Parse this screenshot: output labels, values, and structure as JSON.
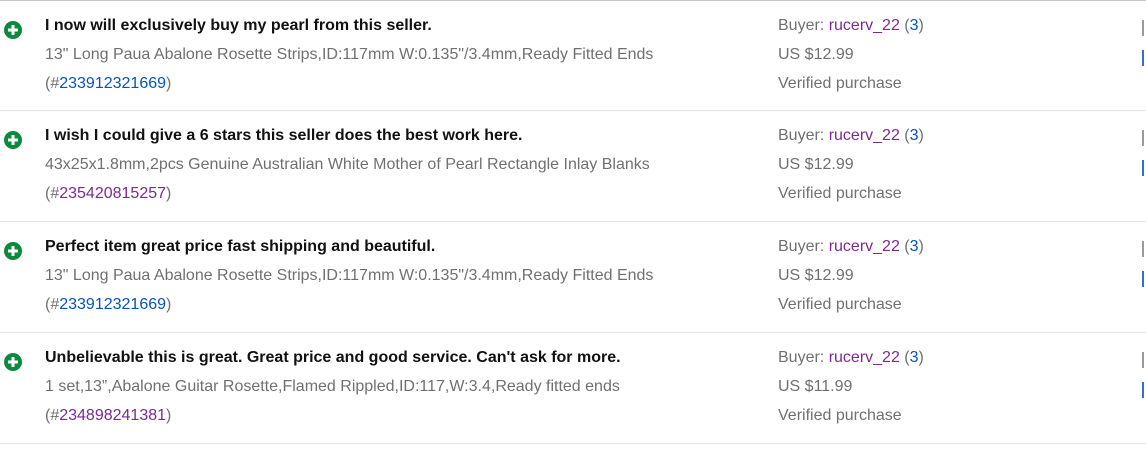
{
  "feedback": [
    {
      "comment": "I now will exclusively buy my pearl from this seller.",
      "item_title": "13\" Long Paua Abalone Rosette Strips,ID:117mm W:0.135\"/3.4mm,Ready Fitted Ends",
      "item_number_open": "(#",
      "item_number": "233912321669",
      "item_number_close": ")",
      "buyer_label": "Buyer: ",
      "buyer_name": "rucerv_22",
      "buyer_score_open": " (",
      "buyer_score": "3",
      "buyer_score_close": ")",
      "price": "US $12.99",
      "verified": "Verified purchase"
    },
    {
      "comment": "I wish I could give a 6 stars this seller does the best work here.",
      "item_title": "43x25x1.8mm,2pcs Genuine Australian White Mother of Pearl Rectangle Inlay Blanks",
      "item_number_open": "(#",
      "item_number": "235420815257",
      "item_number_close": ")",
      "buyer_label": "Buyer: ",
      "buyer_name": "rucerv_22",
      "buyer_score_open": " (",
      "buyer_score": "3",
      "buyer_score_close": ")",
      "price": "US $12.99",
      "verified": "Verified purchase"
    },
    {
      "comment": "Perfect item great price fast shipping and beautiful.",
      "item_title": "13\" Long Paua Abalone Rosette Strips,ID:117mm W:0.135\"/3.4mm,Ready Fitted Ends",
      "item_number_open": "(#",
      "item_number": "233912321669",
      "item_number_close": ")",
      "buyer_label": "Buyer: ",
      "buyer_name": "rucerv_22",
      "buyer_score_open": " (",
      "buyer_score": "3",
      "buyer_score_close": ")",
      "price": "US $12.99",
      "verified": "Verified purchase"
    },
    {
      "comment": "Unbelievable this is great. Great price and good service. Can't ask for more.",
      "item_title": "1 set,13”,Abalone Guitar Rosette,Flamed Rippled,ID:117,W:3.4,Ready fitted ends",
      "item_number_open": "(#",
      "item_number": "234898241381",
      "item_number_close": ")",
      "buyer_label": "Buyer: ",
      "buyer_name": "rucerv_22",
      "buyer_score_open": " (",
      "buyer_score": "3",
      "buyer_score_close": ")",
      "price": "US $11.99",
      "verified": "Verified purchase"
    }
  ],
  "icons": {
    "rating": "positive-plus-icon"
  },
  "colors": {
    "positive_icon": "#0b8a3e",
    "link_blue": "#0654ba",
    "link_visited": "#7b2a91",
    "secondary_text": "#707070",
    "comment_text": "#111111"
  }
}
